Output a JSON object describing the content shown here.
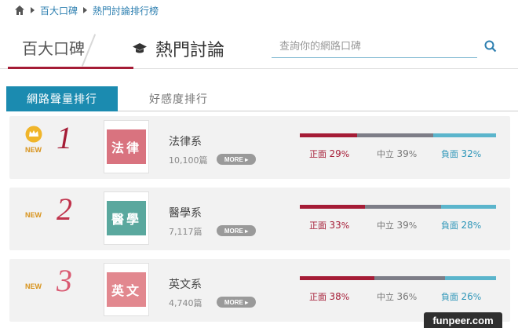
{
  "breadcrumb": {
    "items": [
      "百大口碑",
      "熱門討論排行榜"
    ]
  },
  "header": {
    "tab_koubei": "百大口碑",
    "tab_hot": "熱門討論",
    "search_placeholder": "查詢你的網路口碑"
  },
  "rank_tabs": {
    "active": "網路聲量排行",
    "other": "好感度排行"
  },
  "more_label": "MORE",
  "stat_labels": {
    "positive": "正面",
    "neutral": "中立",
    "negative": "負面"
  },
  "items": [
    {
      "rank": "1",
      "badge": "NEW",
      "crown": true,
      "tile": "法律",
      "tile_color": "#d9737f",
      "rank_color": "#a51c36",
      "name": "法律系",
      "count": "10,100篇",
      "positive": 29,
      "neutral": 39,
      "negative": 32
    },
    {
      "rank": "2",
      "badge": "NEW",
      "crown": false,
      "tile": "醫學",
      "tile_color": "#5aa89e",
      "rank_color": "#c0334c",
      "name": "醫學系",
      "count": "7,117篇",
      "positive": 33,
      "neutral": 39,
      "negative": 28
    },
    {
      "rank": "3",
      "badge": "NEW",
      "crown": false,
      "tile": "英文",
      "tile_color": "#e2888f",
      "rank_color": "#d95a72",
      "name": "英文系",
      "count": "4,740篇",
      "positive": 38,
      "neutral": 36,
      "negative": 26
    }
  ],
  "colors": {
    "positive": "#a51c36",
    "neutral": "#7d7d87",
    "negative": "#5bb5cc",
    "accent": "#1b8bb0"
  },
  "watermark": "funpeer.com"
}
